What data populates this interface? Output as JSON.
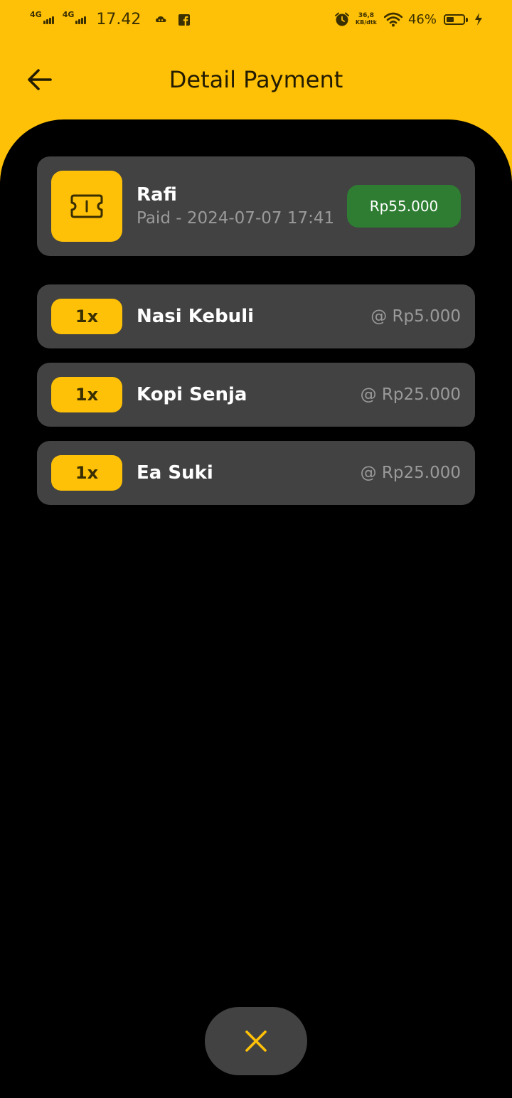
{
  "status_bar": {
    "network_1": "4G",
    "network_2": "4G",
    "time": "17.42",
    "speed_value": "36,8",
    "speed_unit": "KB/dtk",
    "battery": "46%",
    "battery_level": 0.46
  },
  "header": {
    "title": "Detail Payment",
    "back_icon": "arrow-left-icon"
  },
  "summary": {
    "icon": "ticket-icon",
    "customer": "Rafi",
    "meta": "Paid - 2024-07-07 17:41",
    "amount": "Rp55.000"
  },
  "items": [
    {
      "qty": "1x",
      "name": "Nasi Kebuli",
      "price": "@ Rp5.000"
    },
    {
      "qty": "1x",
      "name": "Kopi Senja",
      "price": "@ Rp25.000"
    },
    {
      "qty": "1x",
      "name": "Ea Suki",
      "price": "@ Rp25.000"
    }
  ],
  "close_button": {
    "icon": "close-icon"
  },
  "colors": {
    "accent": "#FFC107",
    "card": "#424242",
    "paid": "#2E7D32",
    "background": "#000000"
  }
}
